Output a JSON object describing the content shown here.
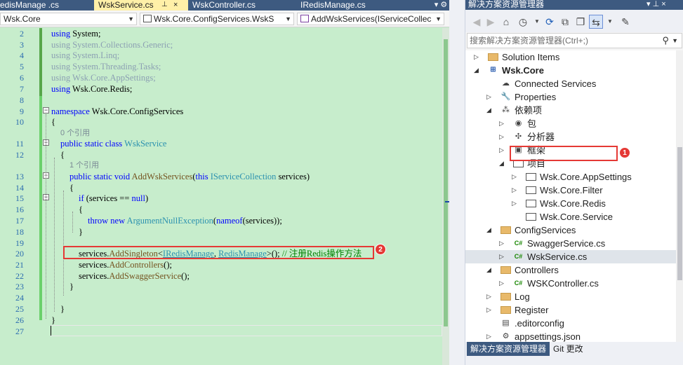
{
  "editor": {
    "tabs": [
      {
        "label": "edisManage .cs",
        "active": false
      },
      {
        "label": "WskService.cs",
        "active": true
      },
      {
        "label": "WskController.cs",
        "active": false
      },
      {
        "label": "IRedisManage.cs",
        "active": false
      }
    ],
    "active_tab_pin": "⊥",
    "active_tab_close": "×",
    "tab_overflow": "▾ ⚙",
    "nav": {
      "project": "Wsk.Core",
      "type": "Wsk.Core.ConfigServices.WskS",
      "member": "AddWskServices(IServiceCollec"
    },
    "line_numbers": [
      "2",
      "3",
      "4",
      "5",
      "6",
      "7",
      "8",
      "9",
      "10",
      "",
      "11",
      "12",
      "",
      "13",
      "14",
      "15",
      "16",
      "17",
      "18",
      "19",
      "20",
      "21",
      "22",
      "23",
      "24",
      "25",
      "26",
      "27"
    ],
    "code": {
      "l2_kw": "using",
      "l2_rest": " System;",
      "l3": "using System.Collections.Generic;",
      "l4": "using System.Linq;",
      "l5": "using System.Threading.Tasks;",
      "l6": "using Wsk.Core.AppSettings;",
      "l7_kw": "using",
      "l7_rest": " Wsk.Core.Redis;",
      "l9_kw": "namespace",
      "l9_rest": " Wsk.Core.ConfigServices",
      "l10": "{",
      "ref1": "0 个引用",
      "l11_kw": "public static class",
      "l11_type": " WskService",
      "l12": "{",
      "ref2": "1 个引用",
      "l13_kw": "public static void",
      "l13_name": " AddWskServices",
      "l13_p1": "(",
      "l13_this": "this",
      "l13_ty": " IServiceCollection",
      "l13_end": " services)",
      "l14": "{",
      "l15_kw": "if",
      "l15_a": " (services == ",
      "l15_null": "null",
      "l15_b": ")",
      "l16": "{",
      "l17_kw": "throw new",
      "l17_ty": " ArgumentNullException",
      "l17_a": "(",
      "l17_nameof": "nameof",
      "l17_b": "(services));",
      "l18": "}",
      "l20_a": "services.",
      "l20_m": "AddSingleton",
      "l20_lt": "<",
      "l20_t1": "IRedisManage",
      "l20_comma": ", ",
      "l20_t2": "RedisManage",
      "l20_gt": ">(); ",
      "l20_cm": "// 注册Redis操作方法",
      "l21_a": "services.",
      "l21_m": "AddControllers",
      "l21_b": "();",
      "l22_a": "services.",
      "l22_m": "AddSwaggerService",
      "l22_b": "();",
      "l23": "}",
      "l25": "}",
      "l26": "}"
    },
    "badge_2": "2"
  },
  "explorer": {
    "title": "解决方案资源管理器",
    "title_buttons": "▾ ⊥ ×",
    "toolbar_icons": [
      "back-icon",
      "forward-icon",
      "home-icon",
      "history-icon",
      "refresh-icon",
      "collapse-all-icon",
      "show-all-files-icon",
      "sync-icon",
      "properties-icon"
    ],
    "search_placeholder": "搜索解决方案资源管理器(Ctrl+;)",
    "tree": [
      {
        "label": "Solution Items",
        "indent": 0,
        "expander": "▷",
        "icon": "folder",
        "bold": false
      },
      {
        "label": "Wsk.Core",
        "indent": 0,
        "expander": "◢",
        "icon": "project",
        "bold": true
      },
      {
        "label": "Connected Services",
        "indent": 1,
        "expander": "",
        "icon": "connected-services",
        "bold": false
      },
      {
        "label": "Properties",
        "indent": 1,
        "expander": "▷",
        "icon": "wrench",
        "bold": false
      },
      {
        "label": "依赖项",
        "indent": 1,
        "expander": "◢",
        "icon": "dependencies",
        "bold": false
      },
      {
        "label": "包",
        "indent": 2,
        "expander": "▷",
        "icon": "package",
        "bold": false
      },
      {
        "label": "分析器",
        "indent": 2,
        "expander": "▷",
        "icon": "analyzer",
        "bold": false
      },
      {
        "label": "框架",
        "indent": 2,
        "expander": "▷",
        "icon": "framework",
        "bold": false
      },
      {
        "label": "项目",
        "indent": 2,
        "expander": "◢",
        "icon": "project-ref",
        "bold": false
      },
      {
        "label": "Wsk.Core.AppSettings",
        "indent": 3,
        "expander": "▷",
        "icon": "project-ref",
        "bold": false
      },
      {
        "label": "Wsk.Core.Filter",
        "indent": 3,
        "expander": "▷",
        "icon": "project-ref",
        "bold": false
      },
      {
        "label": "Wsk.Core.Redis",
        "indent": 3,
        "expander": "▷",
        "icon": "project-ref",
        "bold": false
      },
      {
        "label": "Wsk.Core.Service",
        "indent": 3,
        "expander": "",
        "icon": "project-ref",
        "bold": false
      },
      {
        "label": "ConfigServices",
        "indent": 1,
        "expander": "◢",
        "icon": "folder",
        "bold": false
      },
      {
        "label": "SwaggerService.cs",
        "indent": 2,
        "expander": "▷",
        "icon": "csharp",
        "bold": false
      },
      {
        "label": "WskService.cs",
        "indent": 2,
        "expander": "▷",
        "icon": "csharp",
        "bold": false,
        "selected": true
      },
      {
        "label": "Controllers",
        "indent": 1,
        "expander": "◢",
        "icon": "folder",
        "bold": false
      },
      {
        "label": "WSKController.cs",
        "indent": 2,
        "expander": "▷",
        "icon": "csharp",
        "bold": false
      },
      {
        "label": "Log",
        "indent": 1,
        "expander": "▷",
        "icon": "folder",
        "bold": false
      },
      {
        "label": "Register",
        "indent": 1,
        "expander": "▷",
        "icon": "folder",
        "bold": false
      },
      {
        "label": ".editorconfig",
        "indent": 1,
        "expander": "",
        "icon": "config",
        "bold": false
      },
      {
        "label": "appsettings.json",
        "indent": 1,
        "expander": "▷",
        "icon": "json",
        "bold": false
      }
    ],
    "badge_1": "1",
    "bottom_tabs": [
      "解决方案资源管理器",
      "Git 更改"
    ]
  }
}
